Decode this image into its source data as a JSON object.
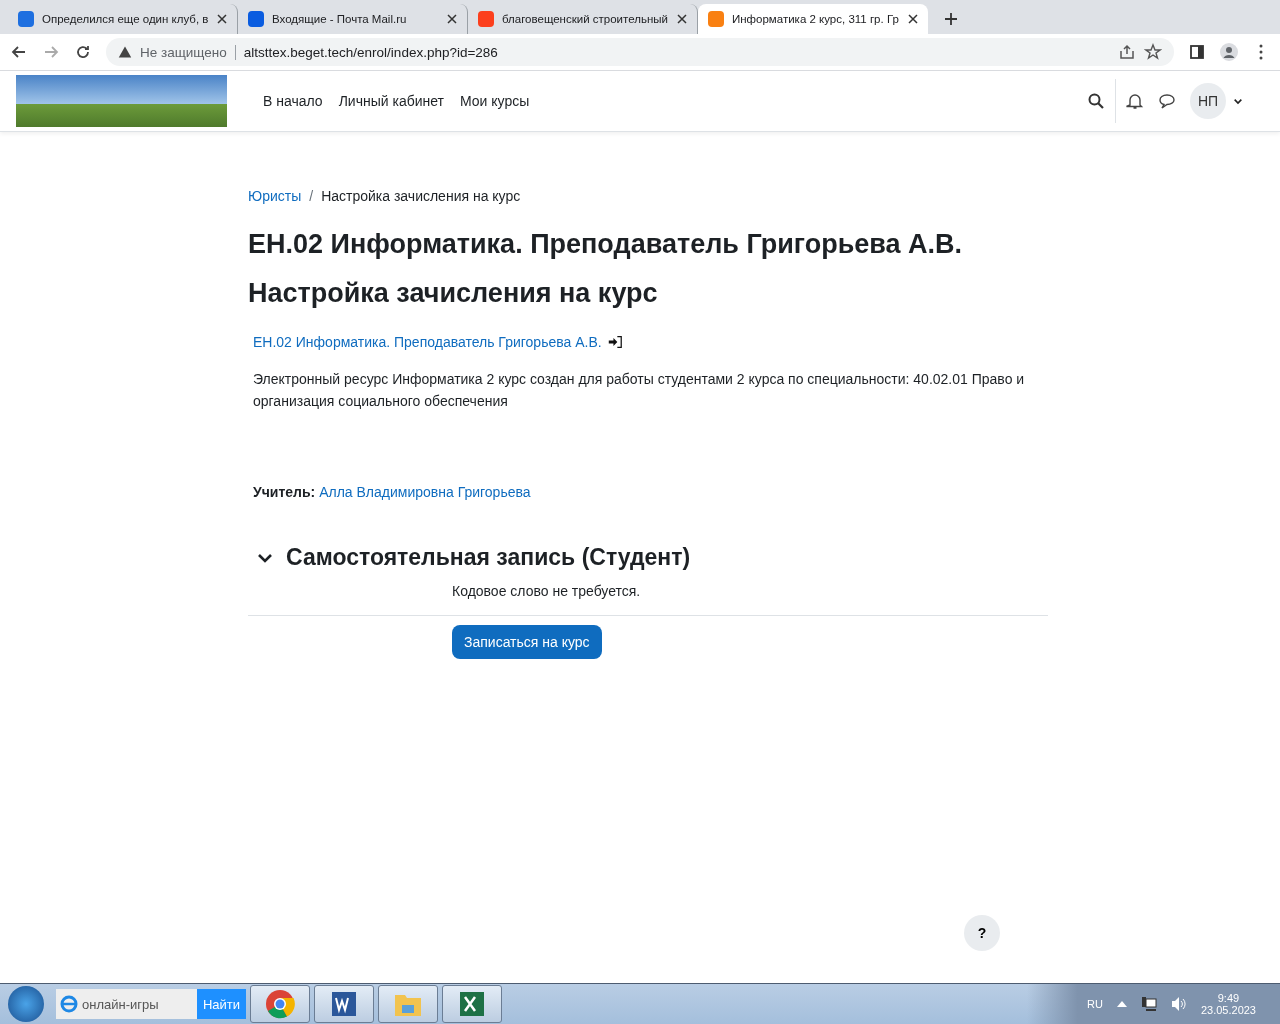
{
  "browser": {
    "tabs": [
      {
        "title": "Определился еще один клуб, в",
        "kind": "a",
        "selected": false
      },
      {
        "title": "Входящие - Почта Mail.ru",
        "kind": "a",
        "selected": false
      },
      {
        "title": "благовещенский строительный",
        "kind": "a",
        "selected": false
      },
      {
        "title": "Информатика 2 курс, 311 гр. Гр",
        "kind": "a",
        "selected": true
      }
    ],
    "security": "Не защищено",
    "url": "altsttex.beget.tech/enrol/index.php?id=286"
  },
  "header": {
    "nav": [
      "В начало",
      "Личный кабинет",
      "Мои курсы"
    ],
    "user_initials": "НП"
  },
  "breadcrumb": [
    {
      "label": "Юристы",
      "kind": "link"
    },
    {
      "label": "/",
      "kind": "separator"
    },
    {
      "label": "Настройка зачисления на курс",
      "kind": "current"
    }
  ],
  "title": "ЕН.02 Информатика. Преподаватель Григорьева А.В.",
  "subtitle": "Настройка зачисления на курс",
  "course": {
    "link": "ЕН.02 Информатика. Преподаватель Григорьева А.В.",
    "summary": "Электронный ресурс Информатика 2 курс создан для работы студентами 2 курса по специальности: 40.02.01 Право и организация социального обеспечения",
    "teacher_label": "Учитель:",
    "teacher": "Алла Владимировна Григорьева"
  },
  "enrol": {
    "title": "Самостоятельная запись (Студент)",
    "expanded": true,
    "note": "Кодовое слово не требуется.",
    "button": "Записаться на курс"
  },
  "help": "?",
  "taskbar": {
    "search": "онлайн-игры",
    "search_button": "Найти",
    "lang": "RU",
    "time": "9:49",
    "date": "23.05.2023"
  }
}
